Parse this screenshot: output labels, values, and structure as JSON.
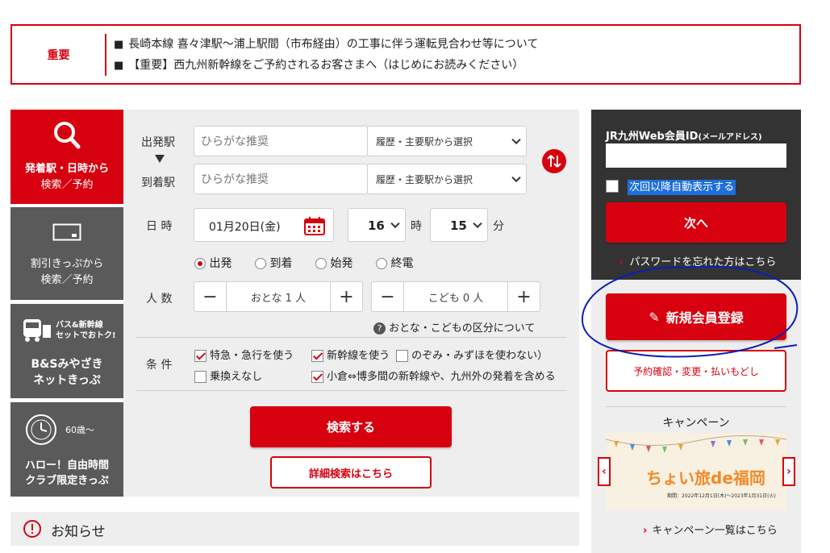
{
  "notice": {
    "label": "重要",
    "items": [
      "長崎本線 喜々津駅～浦上駅間（市布経由）の工事に伴う運転見合わせ等について",
      "【重要】西九州新幹線をご予約されるお客さまへ（はじめにお読みください）"
    ],
    "bullet": "■"
  },
  "tabs": [
    {
      "icon": "search-icon",
      "line1": "発着駅・日時から",
      "line2": "検索／予約"
    },
    {
      "icon": "ticket-icon",
      "line1": "割引きっぷから",
      "line2": "検索／予約"
    },
    {
      "icon": "bus-train-icon",
      "badge": "バス&新幹線\nセットでおトク!",
      "line1": "B&Sみやざき",
      "line2": "ネットきっぷ"
    },
    {
      "icon": "clock-logo-icon",
      "badge": "60歳～",
      "line1": "ハロー！自由時間",
      "line2": "クラブ限定きっぷ"
    }
  ],
  "form": {
    "departure_label": "出発駅",
    "arrival_label": "到着駅",
    "station_placeholder": "ひらがな推奨",
    "station_select": "履歴・主要駅から選択",
    "datetime_label": "日 時",
    "date_value": "01月20日(金)",
    "hour_value": "16",
    "hour_unit": "時",
    "minute_value": "15",
    "minute_unit": "分",
    "time_options": [
      "出発",
      "到着",
      "始発",
      "終電"
    ],
    "people_label": "人 数",
    "adult_value": "おとな 1 人",
    "child_value": "こども 0 人",
    "minus": "−",
    "plus": "+",
    "help_text": "おとな・こどもの区分について",
    "conditions_label": "条 件",
    "cond_express": "特急・急行を使う",
    "cond_shinkansen": "新幹線を使う（",
    "cond_nozomi": "のぞみ・みずほを使わない）",
    "cond_no_transfer": "乗換えなし",
    "cond_kokura": "小倉⇔博多間の新幹線や、九州外の発着を含める",
    "search_button": "検索する",
    "detail_search_button": "詳細検索はこちら"
  },
  "login": {
    "id_label": "JR九州Web会員ID",
    "id_label_sub": "(メールアドレス)",
    "auto_display": "次回以降自動表示する",
    "next_button": "次へ",
    "forgot_password": "パスワードを忘れた方はこちら"
  },
  "member": {
    "register_button": "新規会員登録",
    "reservation_button": "予約確認・変更・払いもどし"
  },
  "campaign": {
    "title": "キャンペーン",
    "banner_text": "ちょい旅de福岡",
    "banner_period": "期間：2022年12月1日(木)～2023年1月31日(火)",
    "list_link": "キャンペーン一覧はこちら"
  },
  "news": {
    "title": "お知らせ"
  },
  "colors": {
    "accent": "#d7000f",
    "tab_gray": "#5a5a5a",
    "panel_gray": "#eeeeee",
    "login_dark": "#333333",
    "annotation_blue": "#0a1fb8"
  }
}
